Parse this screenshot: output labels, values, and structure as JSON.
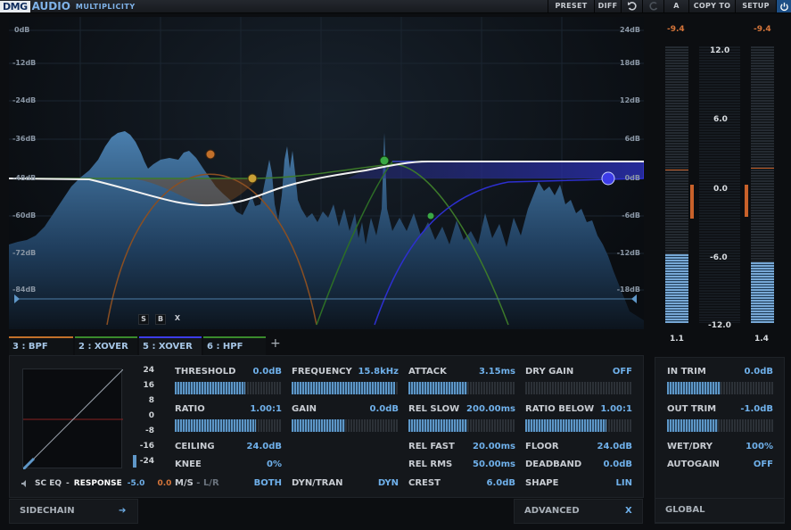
{
  "header": {
    "brand": "DMG",
    "brand2": "AUDIO",
    "product": "MULTIPLICITY",
    "buttons": {
      "preset": "PRESET",
      "diff": "DIFF",
      "ab": "A",
      "copy": "COPY TO",
      "setup": "SETUP"
    }
  },
  "graph": {
    "left_scale": [
      "0dB",
      "-12dB",
      "-24dB",
      "-36dB",
      "-48dB",
      "-60dB",
      "-72dB",
      "-84dB"
    ],
    "right_scale": [
      "24dB",
      "18dB",
      "12dB",
      "6dB",
      "0dB",
      "-6dB",
      "-12dB",
      "-18dB"
    ],
    "solo_buttons": [
      "S",
      "B",
      "X"
    ]
  },
  "meters": {
    "left_peak": "-9.4",
    "right_peak": "-9.4",
    "scale": [
      "12.0",
      "6.0",
      "0.0",
      "-6.0",
      "-12.0"
    ],
    "left_value": "1.1",
    "right_value": "1.4",
    "left_level": 0.25,
    "right_level": 0.22,
    "left_gr": 0.32,
    "right_gr": 0.3
  },
  "tabs": [
    {
      "label": "3 : BPF",
      "color": "#c2702a",
      "active": false
    },
    {
      "label": "2 : XOVER",
      "color": "#3a8a2c",
      "active": false
    },
    {
      "label": "5 : XOVER",
      "color": "#3d3ce8",
      "active": true
    },
    {
      "label": "6 : HPF",
      "color": "#3a8a2c",
      "active": false
    }
  ],
  "add_tab": "+",
  "transfer": {
    "scale": [
      "24",
      "16",
      "8",
      "0",
      "-8",
      "-16",
      "-24"
    ],
    "sc_eq": "SC EQ",
    "response": "RESPONSE",
    "resp_blue": "-5.0",
    "resp_orange": "0.0"
  },
  "col1": [
    {
      "label": "THRESHOLD",
      "value": "0.0",
      "unit": "dB",
      "slider": 0.66
    },
    {
      "label": "RATIO",
      "value": "1.00",
      "unit": ":1",
      "slider": 0.76
    },
    {
      "label": "CEILING",
      "value": "24.0",
      "unit": "dB"
    },
    {
      "label": "KNEE",
      "value": "0",
      "unit": "%"
    },
    {
      "label": "M/S",
      "label_sep": "-",
      "label2": "L/R",
      "value": "BOTH",
      "unit": ""
    }
  ],
  "col2": [
    {
      "label": "FREQUENCY",
      "value": "15.8",
      "unit": "kHz",
      "slider": 0.97
    },
    {
      "label": "GAIN",
      "value": "0.0",
      "unit": "dB",
      "slider": 0.5
    },
    {
      "label": "DYN/TRAN",
      "value": "DYN",
      "unit": ""
    }
  ],
  "col3": [
    {
      "label": "ATTACK",
      "value": "3.15",
      "unit": "ms",
      "slider": 0.55
    },
    {
      "label": "REL SLOW",
      "value": "200.00",
      "unit": "ms",
      "slider": 0.55
    },
    {
      "label": "REL FAST",
      "value": "20.00",
      "unit": "ms"
    },
    {
      "label": "REL RMS",
      "value": "50.00",
      "unit": "ms"
    },
    {
      "label": "CREST",
      "value": "6.0",
      "unit": "dB"
    }
  ],
  "col4": [
    {
      "label": "DRY GAIN",
      "value": "OFF",
      "unit": "",
      "slider": 0.0
    },
    {
      "label": "RATIO BELOW",
      "value": "1.00",
      "unit": ":1",
      "slider": 0.76
    },
    {
      "label": "FLOOR",
      "value": "24.0",
      "unit": "dB"
    },
    {
      "label": "DEADBAND",
      "value": "0.0",
      "unit": "dB"
    },
    {
      "label": "SHAPE",
      "value": "LIN",
      "unit": ""
    }
  ],
  "global": [
    {
      "label": "IN TRIM",
      "value": "0.0",
      "unit": "dB",
      "slider": 0.5
    },
    {
      "label": "OUT TRIM",
      "value": "-1.0",
      "unit": "dB",
      "slider": 0.48
    },
    {
      "label": "WET/DRY",
      "value": "100",
      "unit": "%"
    },
    {
      "label": "AUTOGAIN",
      "value": "OFF",
      "unit": ""
    }
  ],
  "footer": {
    "sidechain": "SIDECHAIN",
    "sidechain_arrow": "➔",
    "advanced": "ADVANCED",
    "advanced_x": "X",
    "global": "GLOBAL"
  }
}
